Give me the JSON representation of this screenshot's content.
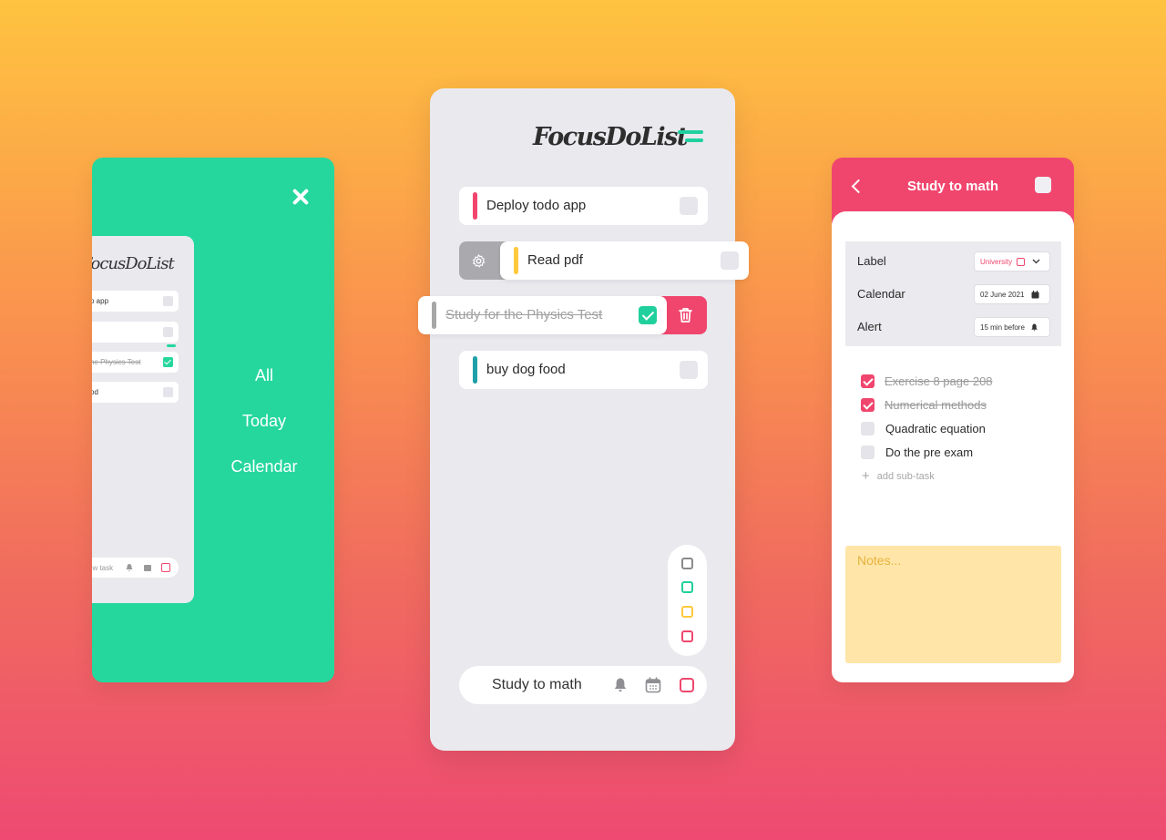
{
  "menu": {
    "items": [
      "All",
      "Today",
      "Calendar"
    ],
    "mini_preview": {
      "logo": "FocusDoList",
      "tasks": [
        {
          "title": "o app",
          "done": false
        },
        {
          "title": "",
          "done": false
        },
        {
          "title": "he Physics Test",
          "done": true
        },
        {
          "title": "od",
          "done": false
        }
      ],
      "new_task_placeholder": "ew task"
    }
  },
  "main": {
    "logo": "FocusDoList",
    "tasks": [
      {
        "title": "Deploy todo app",
        "color": "#f0466e",
        "done": false
      },
      {
        "title": "Read pdf",
        "color": "#ffc93c",
        "done": false
      },
      {
        "title": "Study for the Physics Test",
        "color": "#a6a6a6",
        "done": true
      },
      {
        "title": "buy dog food",
        "color": "#1ea0a8",
        "done": false
      }
    ],
    "color_picker": [
      "#8a8a8a",
      "#20d09c",
      "#ffc93c",
      "#f0466e"
    ],
    "new_task_text": "Study to math"
  },
  "detail": {
    "title": "Study to math",
    "props": {
      "label_title": "Label",
      "label_value": "University",
      "calendar_title": "Calendar",
      "calendar_value": "02 June 2021",
      "alert_title": "Alert",
      "alert_value": "15 min before"
    },
    "subtasks": [
      {
        "title": "Exercise 8 page 208",
        "done": true
      },
      {
        "title": "Numerical methods",
        "done": true
      },
      {
        "title": "Quadratic equation",
        "done": false
      },
      {
        "title": "Do the pre exam",
        "done": false
      }
    ],
    "add_subtask_label": "add sub-task",
    "notes_placeholder": "Notes..."
  },
  "colors": {
    "green": "#25d79d",
    "pink": "#f0466e",
    "yellow": "#ffc93c"
  }
}
